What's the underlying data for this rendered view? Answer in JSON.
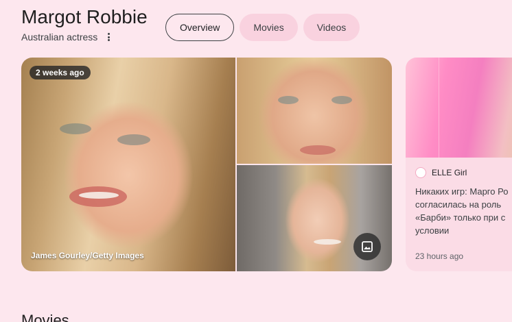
{
  "entity": {
    "name": "Margot Robbie",
    "description": "Australian actress"
  },
  "tabs": [
    {
      "label": "Overview",
      "active": true
    },
    {
      "label": "Movies",
      "active": false
    },
    {
      "label": "Videos",
      "active": false
    }
  ],
  "gallery": {
    "badge": "2 weeks ago",
    "credit": "James Gourley/Getty Images",
    "button_icon": "image-gallery-icon"
  },
  "news": {
    "source": "ELLE Girl",
    "headline": "Никаких игр: Марго Ро согласилась на роль «Барби» только при с условии",
    "time": "23 hours ago"
  },
  "section": {
    "heading": "Movies"
  },
  "colors": {
    "background": "#fde7ee",
    "chip": "#f9d2df",
    "card": "#fbdce6"
  }
}
